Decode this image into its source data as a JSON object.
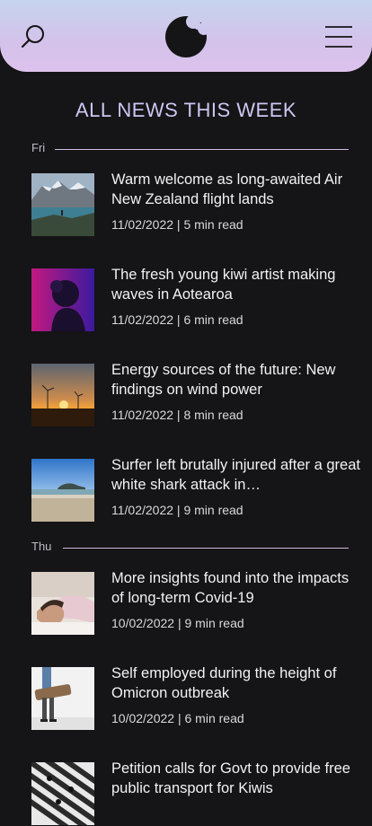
{
  "header": {
    "search_icon": "search-icon",
    "logo_icon": "bitten-moon-logo",
    "menu_icon": "hamburger-menu-icon",
    "colors": {
      "gradient_top": "#c5d4ef",
      "gradient_bottom": "#dcc2ec",
      "logo": "#151416"
    }
  },
  "section": {
    "title": "ALL NEWS THIS WEEK"
  },
  "days": [
    {
      "label": "Fri"
    },
    {
      "label": "Thu"
    }
  ],
  "articles": [
    {
      "headline": "Warm welcome as long-awaited Air New Zealand flight lands",
      "date": "11/02/2022",
      "read": "5 min read",
      "thumb": "mountain-lake-photo"
    },
    {
      "headline": "The fresh young kiwi artist making waves in Aotearoa",
      "date": "11/02/2022",
      "read": "6 min read",
      "thumb": "artist-silhouette-photo"
    },
    {
      "headline": "Energy sources of the future: New findings on wind power",
      "date": "11/02/2022",
      "read": "8 min read",
      "thumb": "wind-turbine-sunset-photo"
    },
    {
      "headline": "Surfer left brutally injured after a great white shark attack in…",
      "date": "11/02/2022",
      "read": "9 min read",
      "thumb": "beach-photo"
    },
    {
      "headline": "More insights found into the impacts of long-term Covid-19",
      "date": "10/02/2022",
      "read": "9 min read",
      "thumb": "sick-in-bed-photo"
    },
    {
      "headline": "Self employed during the height of Omicron outbreak",
      "date": "10/02/2022",
      "read": "6 min read",
      "thumb": "worker-carrying-photo"
    },
    {
      "headline": "Petition calls for Govt to provide free public transport for Kiwis",
      "date": "",
      "read": "",
      "thumb": "crosswalk-photo"
    }
  ],
  "colors": {
    "background": "#151416",
    "title": "#cdc6f2",
    "divider": "#d0bde0"
  }
}
